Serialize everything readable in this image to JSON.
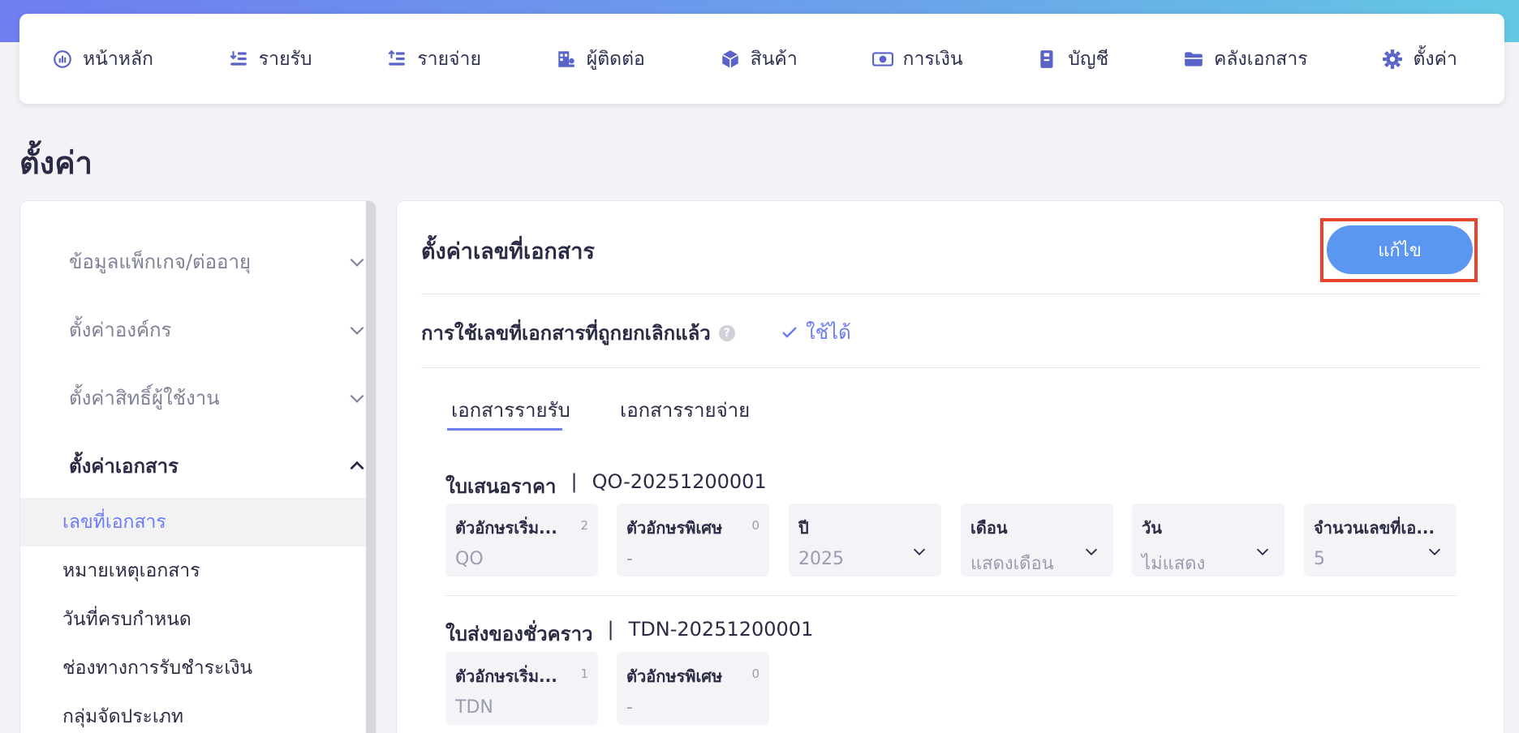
{
  "nav": {
    "items": [
      {
        "label": "หน้าหลัก",
        "icon": "dashboard-icon"
      },
      {
        "label": "รายรับ",
        "icon": "income-icon"
      },
      {
        "label": "รายจ่าย",
        "icon": "expense-icon"
      },
      {
        "label": "ผู้ติดต่อ",
        "icon": "contacts-icon"
      },
      {
        "label": "สินค้า",
        "icon": "box-icon"
      },
      {
        "label": "การเงิน",
        "icon": "money-icon"
      },
      {
        "label": "บัญชี",
        "icon": "ledger-icon"
      },
      {
        "label": "คลังเอกสาร",
        "icon": "folder-icon"
      },
      {
        "label": "ตั้งค่า",
        "icon": "gear-icon"
      }
    ]
  },
  "page": {
    "title": "ตั้งค่า"
  },
  "sidebar": {
    "groups": [
      {
        "label": "ข้อมูลแพ็กเกจ/ต่ออายุ",
        "expanded": false
      },
      {
        "label": "ตั้งค่าองค์กร",
        "expanded": false
      },
      {
        "label": "ตั้งค่าสิทธิ์ผู้ใช้งาน",
        "expanded": false
      },
      {
        "label": "ตั้งค่าเอกสาร",
        "expanded": true
      }
    ],
    "subitems": [
      {
        "label": "เลขที่เอกสาร",
        "active": true
      },
      {
        "label": "หมายเหตุเอกสาร"
      },
      {
        "label": "วันที่ครบกำหนด"
      },
      {
        "label": "ช่องทางการรับชำระเงิน"
      },
      {
        "label": "กลุ่มจัดประเภท"
      }
    ]
  },
  "main": {
    "title": "ตั้งค่าเลขที่เอกสาร",
    "edit_label": "แก้ไข",
    "cancelled_label": "การใช้เลขที่เอกสารที่ถูกยกเลิกแล้ว",
    "help_glyph": "?",
    "cancelled_value": "ใช้ได้",
    "tabs": [
      {
        "label": "เอกสารรายรับ",
        "active": true
      },
      {
        "label": "เอกสารรายจ่าย"
      }
    ],
    "docs": [
      {
        "name": "ใบเสนอราคา",
        "sep": "|",
        "example": "QO-20251200001",
        "fields": [
          {
            "label": "ตัวอักษรเริ่ม...",
            "count": "2",
            "value": "QO"
          },
          {
            "label": "ตัวอักษรพิเศษ",
            "count": "0",
            "value": "-"
          },
          {
            "label": "ปี",
            "value": "2025",
            "dropdown": true
          },
          {
            "label": "เดือน",
            "value": "แสดงเดือน",
            "dropdown": true
          },
          {
            "label": "วัน",
            "value": "ไม่แสดง",
            "dropdown": true
          },
          {
            "label": "จำนวนเลขที่เอ...",
            "value": "5",
            "dropdown": true
          }
        ]
      },
      {
        "name": "ใบส่งของชั่วคราว",
        "sep": "|",
        "example": "TDN-20251200001",
        "fields": [
          {
            "label": "ตัวอักษรเริ่ม...",
            "count": "1",
            "value": "TDN"
          },
          {
            "label": "ตัวอักษรพิเศษ",
            "count": "0",
            "value": "-"
          }
        ]
      }
    ]
  },
  "colors": {
    "accent": "#6d7cf2",
    "button": "#5b97f0",
    "highlight": "#e8442b"
  }
}
